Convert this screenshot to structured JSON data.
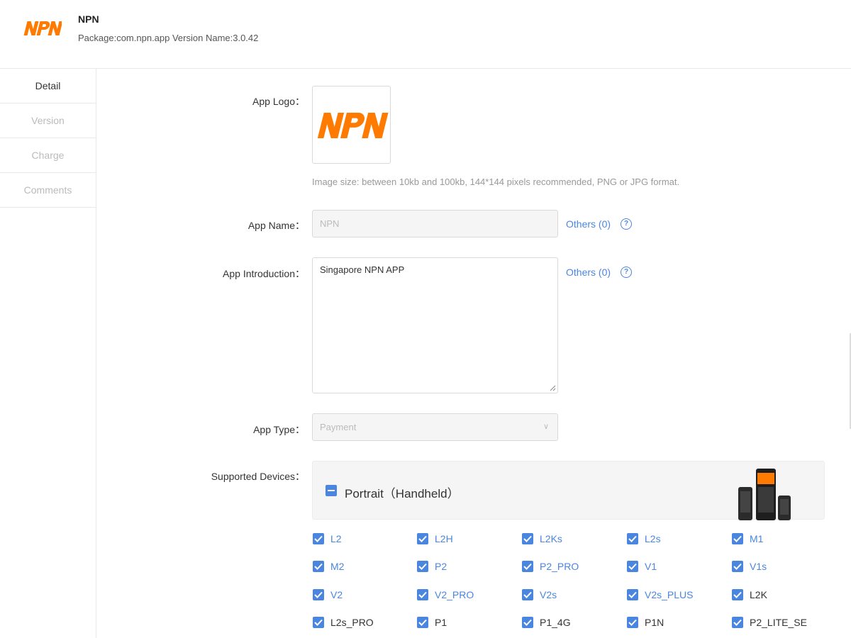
{
  "header": {
    "logo_text": "NPN",
    "app_name": "NPN",
    "meta": "Package:com.npn.app Version Name:3.0.42"
  },
  "sidebar": {
    "items": [
      {
        "label": "Detail",
        "active": true
      },
      {
        "label": "Version",
        "active": false
      },
      {
        "label": "Charge",
        "active": false
      },
      {
        "label": "Comments",
        "active": false
      }
    ]
  },
  "form": {
    "logo_label": "App Logo：",
    "logo_hint": "Image size: between 10kb and 100kb, 144*144 pixels recommended, PNG or JPG format.",
    "name_label": "App Name：",
    "name_value": "NPN",
    "others_name": "Others (0)",
    "intro_label": "App Introduction：",
    "intro_value": "Singapore NPN APP",
    "others_intro": "Others (0)",
    "type_label": "App Type：",
    "type_value": "Payment",
    "devices_label": "Supported Devices：",
    "device_group": "Portrait（Handheld）",
    "devices": [
      "L2",
      "L2H",
      "L2Ks",
      "L2s",
      "M1",
      "M2",
      "P2",
      "P2_PRO",
      "V1",
      "V1s",
      "V2",
      "V2_PRO",
      "V2s",
      "V2s_PLUS",
      "L2K",
      "L2s_PRO",
      "P1",
      "P1_4G",
      "P1N",
      "P2_LITE_SE"
    ]
  },
  "colors": {
    "accent": "#4a86e0",
    "brand_orange": "#ff7a00"
  }
}
